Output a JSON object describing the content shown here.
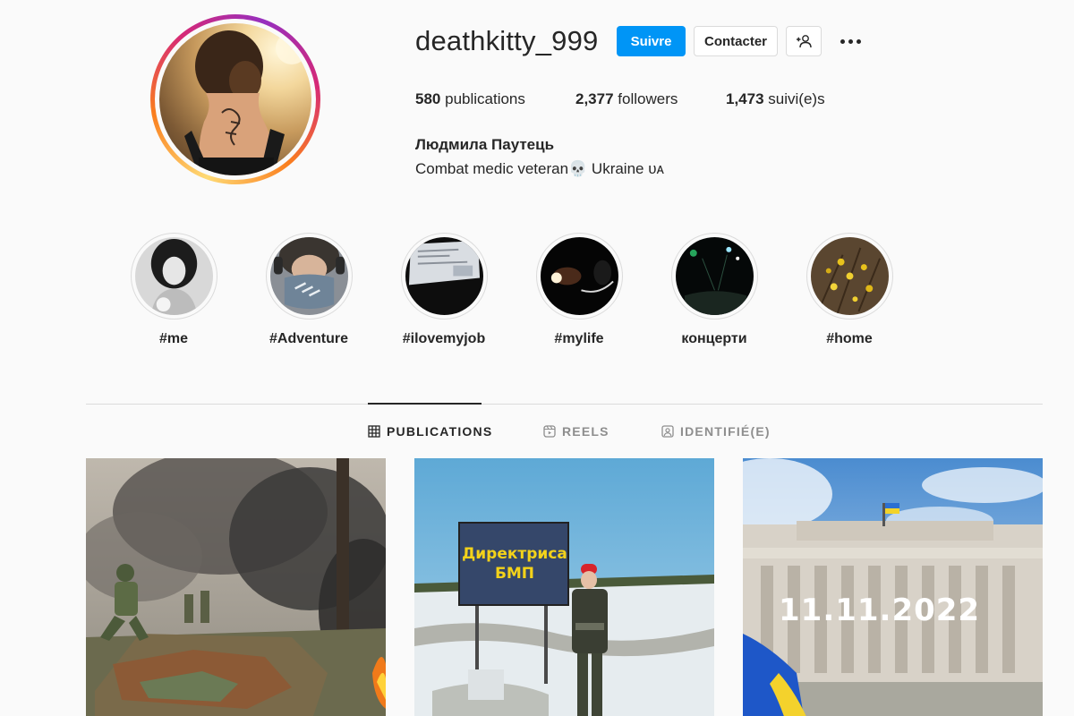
{
  "profile": {
    "username": "deathkitty_999",
    "follow_label": "Suivre",
    "contact_label": "Contacter",
    "stats": {
      "posts_count": "580",
      "posts_label": "publications",
      "followers_count": "2,377",
      "followers_label": "followers",
      "following_count": "1,473",
      "following_label": "suivi(e)s"
    },
    "full_name": "Людмила Паутець",
    "bio": "Combat medic veteran💀 Ukraine ᴜᴀ"
  },
  "highlights": [
    {
      "label": "#me",
      "icon": "portrait-bw"
    },
    {
      "label": "#Adventure",
      "icon": "masked-face"
    },
    {
      "label": "#ilovemyjob",
      "icon": "screen-dark"
    },
    {
      "label": "#mylife",
      "icon": "night-light"
    },
    {
      "label": "концерти",
      "icon": "concert-stage"
    },
    {
      "label": "#home",
      "icon": "yellow-flowers"
    }
  ],
  "tabs": [
    {
      "label": "PUBLICATIONS",
      "icon": "grid-icon",
      "active": true
    },
    {
      "label": "REELS",
      "icon": "reels-icon",
      "active": false
    },
    {
      "label": "IDENTIFIÉ(E)",
      "icon": "tagged-icon",
      "active": false
    }
  ],
  "posts": [
    {
      "subject": "soldiers-on-burning-vehicle"
    },
    {
      "subject": "soldier-with-sign",
      "sign_line1": "Директриса",
      "sign_line2": "БМП"
    },
    {
      "subject": "city-building-flag",
      "overlay_text": "11.11.2022"
    }
  ],
  "colors": {
    "accent": "#0095f6",
    "text": "#262626",
    "muted": "#8e8e8e",
    "border": "#dbdbdb",
    "background": "#fafafa"
  }
}
